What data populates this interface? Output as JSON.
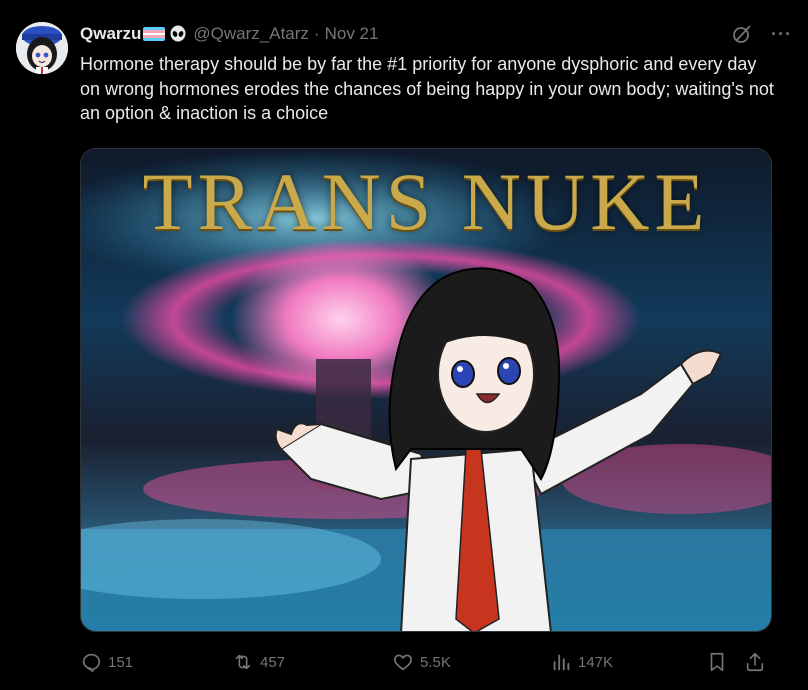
{
  "author": {
    "display_name": "Qwarzu",
    "handle": "@Qwarz_Atarz",
    "separator": "·",
    "date": "Nov 21"
  },
  "tweet": {
    "text": "Hormone therapy should be by far the #1 priority for anyone dysphoric and every day on wrong hormones erodes the chances of being happy in your own body; waiting's not an option & inaction is a choice"
  },
  "media": {
    "title_text": "TRANS NUKE"
  },
  "actions": {
    "replies": "151",
    "reposts": "457",
    "likes": "5.5K",
    "views": "147K"
  },
  "icons": {
    "header": [
      "trans-flag-icon",
      "alien-icon",
      "grok-icon",
      "more-icon"
    ],
    "actions": [
      "reply-icon",
      "repost-icon",
      "like-icon",
      "views-icon",
      "bookmark-icon",
      "share-icon"
    ]
  },
  "colors": {
    "background": "#000000",
    "text": "#e7e9ea",
    "muted": "#71767b",
    "flag_blue": "#5bcefa",
    "flag_pink": "#f5a9b8",
    "flag_white": "#ffffff",
    "title_gold": "#c9a94a"
  }
}
